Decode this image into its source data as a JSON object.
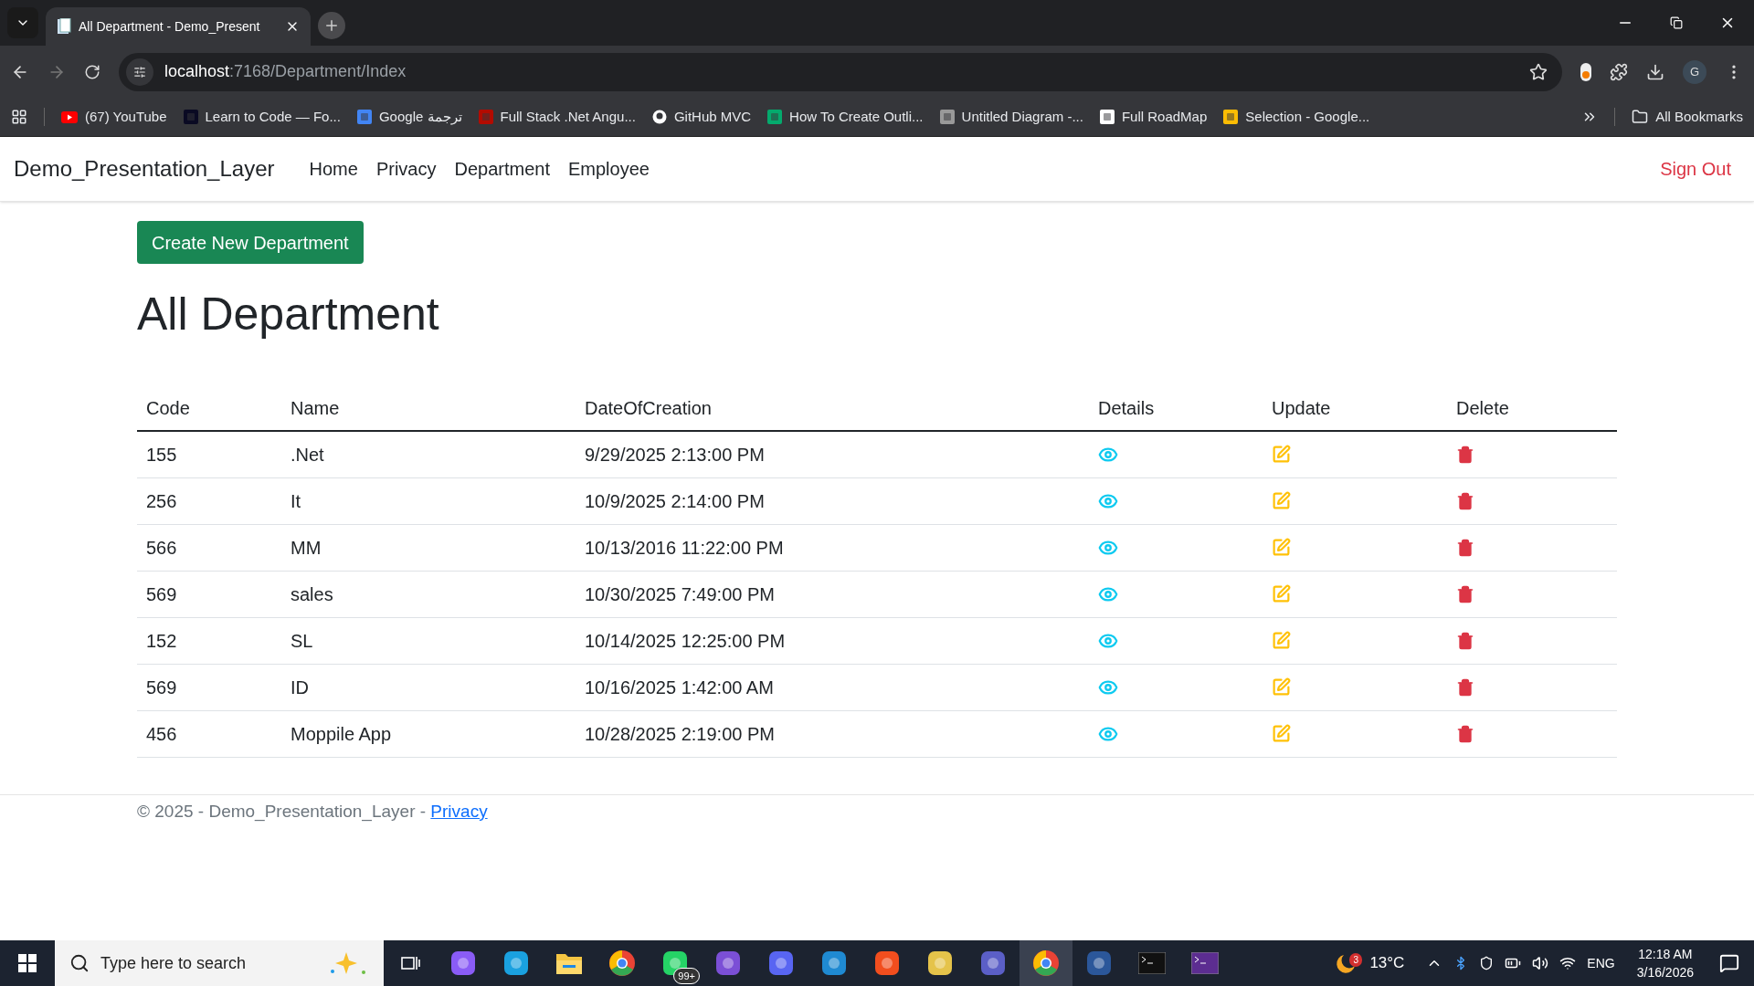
{
  "browser": {
    "tab": {
      "title": "All Department - Demo_Present"
    },
    "url": {
      "host": "localhost",
      "path": ":7168/Department/Index"
    },
    "bookmarks": [
      {
        "kind": "youtube",
        "label": "(67) YouTube"
      },
      {
        "kind": "code",
        "label": "Learn to Code — Fo..."
      },
      {
        "kind": "translate",
        "label": "Google ترجمة"
      },
      {
        "kind": "pdf",
        "label": "Full Stack .Net Angu..."
      },
      {
        "kind": "github",
        "label": "GitHub MVC"
      },
      {
        "kind": "w3",
        "label": "How To Create Outli..."
      },
      {
        "kind": "diagram",
        "label": "Untitled Diagram -..."
      },
      {
        "kind": "notion",
        "label": "Full RoadMap"
      },
      {
        "kind": "selection",
        "label": "Selection - Google..."
      }
    ],
    "all_bookmarks": "All Bookmarks",
    "profile": "G"
  },
  "navbar": {
    "brand": "Demo_Presentation_Layer",
    "links": [
      "Home",
      "Privacy",
      "Department",
      "Employee"
    ],
    "sign_out": "Sign Out"
  },
  "create_button": "Create New Department",
  "heading": "All Department",
  "table": {
    "columns": [
      "Code",
      "Name",
      "DateOfCreation",
      "Details",
      "Update",
      "Delete"
    ],
    "rows": [
      {
        "code": "155",
        "name": ".Net",
        "date": "9/29/2025 2:13:00 PM"
      },
      {
        "code": "256",
        "name": "It",
        "date": "10/9/2025 2:14:00 PM"
      },
      {
        "code": "566",
        "name": "MM",
        "date": "10/13/2016 11:22:00 PM"
      },
      {
        "code": "569",
        "name": "sales",
        "date": "10/30/2025 7:49:00 PM"
      },
      {
        "code": "152",
        "name": "SL",
        "date": "10/14/2025 12:25:00 PM"
      },
      {
        "code": "569",
        "name": "ID",
        "date": "10/16/2025 1:42:00 AM"
      },
      {
        "code": "456",
        "name": "Moppile App",
        "date": "10/28/2025 2:19:00 PM"
      }
    ]
  },
  "footer": {
    "text": "© 2025 - Demo_Presentation_Layer - ",
    "link": "Privacy"
  },
  "taskbar": {
    "search": {
      "placeholder": "Type here to search"
    },
    "apps": [
      {
        "kind": "taskview",
        "selected": false
      },
      {
        "kind": "copilot",
        "selected": false
      },
      {
        "kind": "edge",
        "selected": false
      },
      {
        "kind": "folder",
        "selected": false
      },
      {
        "kind": "chrome",
        "selected": false
      },
      {
        "kind": "whatsapp",
        "selected": false,
        "badge": "99+"
      },
      {
        "kind": "vs",
        "selected": false
      },
      {
        "kind": "discord",
        "selected": false
      },
      {
        "kind": "vscode",
        "selected": false
      },
      {
        "kind": "figma",
        "selected": false
      },
      {
        "kind": "tool",
        "selected": false
      },
      {
        "kind": "teams",
        "selected": false
      },
      {
        "kind": "chrome",
        "selected": true
      },
      {
        "kind": "word",
        "selected": false
      },
      {
        "kind": "terminal",
        "selected": false
      },
      {
        "kind": "console",
        "selected": false
      }
    ],
    "weather": {
      "badge": "3",
      "temp": "13°C"
    },
    "language": "ENG",
    "time": "12:18 AM",
    "date": "3/16/2026"
  }
}
